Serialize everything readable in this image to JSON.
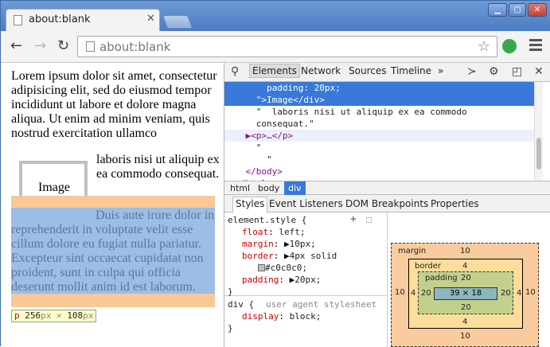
{
  "browser": {
    "tab_title": "about:blank",
    "tab_close": "✕",
    "address": "about:blank",
    "window_buttons": [
      "▁",
      "▢",
      "✕"
    ]
  },
  "page": {
    "lorem": "Lorem ipsum dolor sit amet, consectetur adipisicing elit, sed do eiusmod tempor incididunt ut labore et dolore magna aliqua. Ut enim ad minim veniam, quis nostrud exercitation ullamco",
    "image_label": "Image",
    "laboris": "laboris nisi ut aliquip ex ea commodo consequat.",
    "duis": "Duis aute irure dolor in reprehenderit in voluptate velit esse cillum dolore eu fugiat nulla pariatur. Excepteur sint occaecat cupidatat non proident, sunt in culpa qui officia deserunt mollit anim id est laborum.",
    "tooltip": {
      "tag": "p",
      "width": "256",
      "height": "108",
      "unit": "px",
      "times": "×"
    }
  },
  "devtools": {
    "tabs": [
      "Elements",
      "Network",
      "Sources",
      "Timeline"
    ],
    "more": "»",
    "elements": [
      {
        "text": "        padding: 20px;"
      },
      {
        "text": "      \">Image</div>"
      },
      {
        "text": "      \"  laboris nisi ut aliquip ex ea commodo"
      },
      {
        "text": "      consequat.\""
      },
      {
        "text": "    ▶<p>…</p>"
      },
      {
        "text": "      \""
      },
      {
        "text": "        \""
      },
      {
        "text": "    </body>"
      },
      {
        "text": "  </html>"
      }
    ],
    "breadcrumbs": [
      "html",
      "body",
      "div"
    ],
    "sidebar_tabs": [
      "Styles",
      "Event Listeners",
      "DOM Breakpoints",
      "Properties"
    ],
    "styles": {
      "selector1": "element.style {",
      "rules": [
        {
          "prop": "float",
          "val": "left;"
        },
        {
          "prop": "margin",
          "val": "10px;"
        },
        {
          "prop": "border",
          "val": "4px solid"
        },
        {
          "prop": "",
          "val": "#c0c0c0;"
        },
        {
          "prop": "padding",
          "val": "20px;"
        }
      ],
      "close": "}",
      "selector2": "div {",
      "ua": "user agent stylesheet",
      "ua_prop": "display",
      "ua_val": "block;"
    },
    "boxmodel": {
      "margin_label": "margin",
      "margin": "10",
      "border_label": "border",
      "border": "4",
      "padding_label": "padding",
      "padding": "20",
      "content": "39 × 18"
    }
  }
}
